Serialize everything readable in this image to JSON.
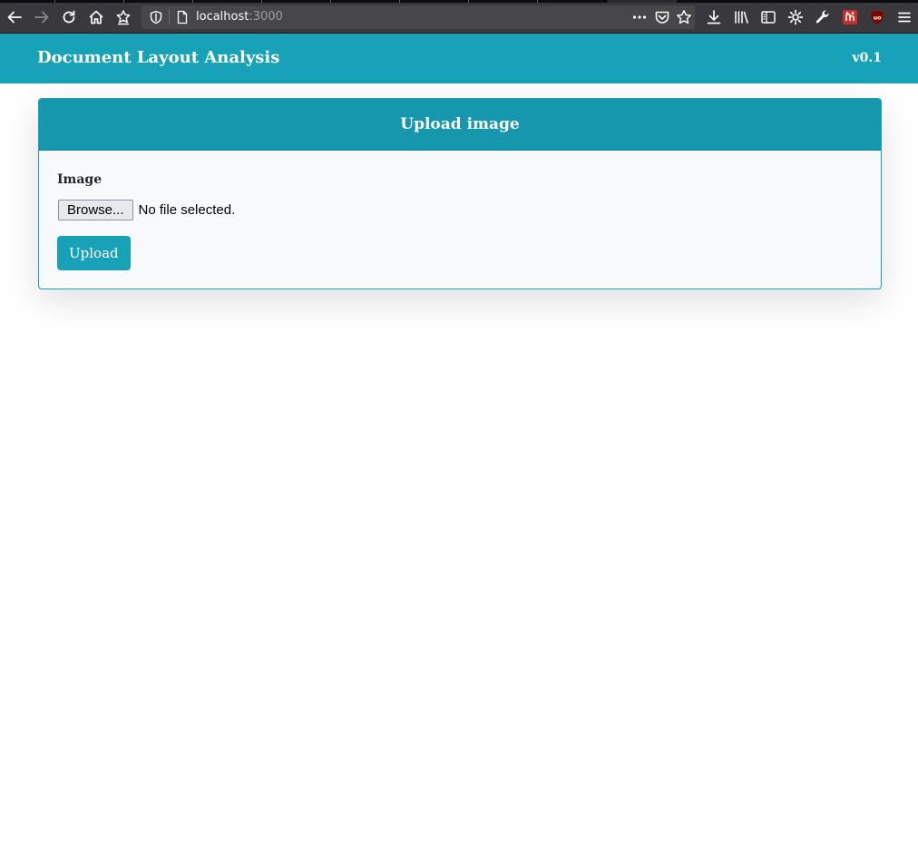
{
  "browser": {
    "url_host": "localhost",
    "url_port": ":3000",
    "colors": {
      "toolbar": "#38383d",
      "urlbar": "#474749",
      "icon": "#f9f9fa"
    },
    "icons": {
      "back": "back-arrow-icon",
      "forward": "forward-arrow-icon",
      "reload": "reload-icon",
      "home": "home-icon",
      "bookmark_star": "bookmark-star-icon",
      "tracking": "shield-icon",
      "page": "page-icon",
      "page_actions": "ellipsis-icon",
      "pocket": "pocket-icon",
      "star": "star-icon",
      "downloads": "download-icon",
      "library": "library-icon",
      "sidebar": "sidebar-icon",
      "gear": "gear-icon",
      "tools": "wrench-icon",
      "extension": "extension-icon",
      "ublock": "ublock-icon",
      "menu": "hamburger-menu-icon"
    }
  },
  "app": {
    "brand": "Document Layout Analysis",
    "version": "v0.1",
    "accent": "#17a2b8"
  },
  "card": {
    "title": "Upload image",
    "field_label": "Image",
    "browse_label": "Browse...",
    "file_status": "No file selected.",
    "upload_label": "Upload"
  }
}
